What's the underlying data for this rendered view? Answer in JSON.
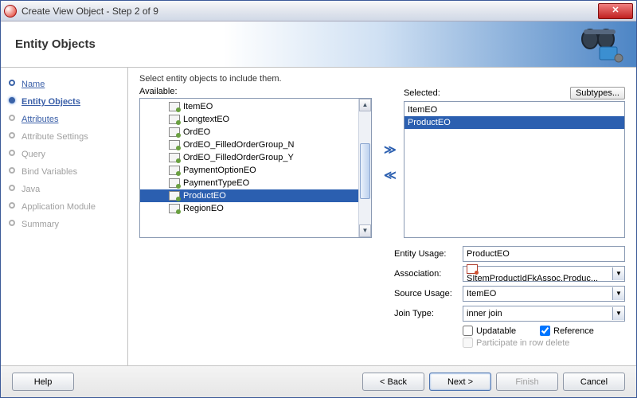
{
  "window": {
    "title": "Create View Object - Step 2 of 9"
  },
  "header": {
    "title": "Entity Objects"
  },
  "steps": [
    {
      "label": "Name",
      "state": "done",
      "enabled": true
    },
    {
      "label": "Entity Objects",
      "state": "current",
      "enabled": true
    },
    {
      "label": "Attributes",
      "state": "future",
      "enabled": true
    },
    {
      "label": "Attribute Settings",
      "state": "future",
      "enabled": false
    },
    {
      "label": "Query",
      "state": "future",
      "enabled": false
    },
    {
      "label": "Bind Variables",
      "state": "future",
      "enabled": false
    },
    {
      "label": "Java",
      "state": "future",
      "enabled": false
    },
    {
      "label": "Application Module",
      "state": "future",
      "enabled": false
    },
    {
      "label": "Summary",
      "state": "future",
      "enabled": false
    }
  ],
  "instruction": "Select entity objects to include them.",
  "labels": {
    "available": "Available:",
    "selected": "Selected:",
    "subtypes": "Subtypes...",
    "entity_usage": "Entity Usage:",
    "association": "Association:",
    "source_usage": "Source Usage:",
    "join_type": "Join Type:",
    "updatable": "Updatable",
    "reference": "Reference",
    "participate": "Participate in row delete"
  },
  "available": [
    {
      "label": "ItemEO",
      "selected": false
    },
    {
      "label": "LongtextEO",
      "selected": false
    },
    {
      "label": "OrdEO",
      "selected": false
    },
    {
      "label": "OrdEO_FilledOrderGroup_N",
      "selected": false
    },
    {
      "label": "OrdEO_FilledOrderGroup_Y",
      "selected": false
    },
    {
      "label": "PaymentOptionEO",
      "selected": false
    },
    {
      "label": "PaymentTypeEO",
      "selected": false
    },
    {
      "label": "ProductEO",
      "selected": true
    },
    {
      "label": "RegionEO",
      "selected": false
    }
  ],
  "selected_list": [
    {
      "label": "ItemEO",
      "selected": false
    },
    {
      "label": "ProductEO",
      "selected": true
    }
  ],
  "form": {
    "entity_usage": "ProductEO",
    "association": "SItemProductIdFkAssoc.Produc...",
    "source_usage": "ItemEO",
    "join_type": "inner join",
    "updatable_checked": false,
    "reference_checked": true,
    "participate_checked": false
  },
  "buttons": {
    "help": "Help",
    "back": "< Back",
    "next": "Next >",
    "finish": "Finish",
    "cancel": "Cancel"
  }
}
